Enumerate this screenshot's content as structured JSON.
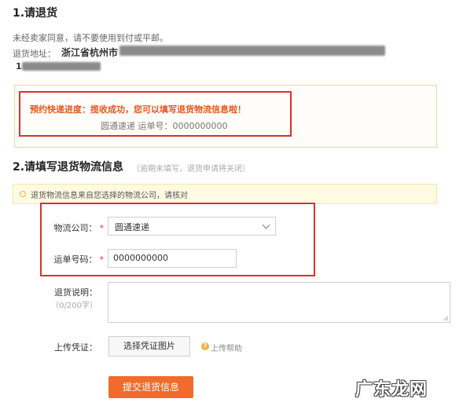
{
  "section1": {
    "title": "1.请退货",
    "note": "未经卖家同意，请不要使用到付或平邮。",
    "address_label": "退货地址：",
    "address_visible": "浙江省杭州市",
    "phone_visible": "1"
  },
  "notice": {
    "progress_label": "预约快递进度：",
    "progress_msg": "揽收成功，您可以填写退货物流信息啦！",
    "courier": "圆通速递",
    "tracking_label": "运单号：",
    "tracking_no": "0000000000"
  },
  "section2": {
    "title": "2.请填写退货物流信息",
    "subtitle": "（逾期未填写，退货申请将关闭）"
  },
  "tip": {
    "text": "退货物流信息来自您选择的物流公司，请核对"
  },
  "form": {
    "company_label": "物流公司：",
    "company_value": "圆通速递",
    "tracking_label": "运单号码：",
    "tracking_value": "0000000000",
    "desc_label": "退货说明：",
    "desc_counter": "（0/200字）",
    "upload_label": "上传凭证：",
    "upload_button": "选择凭证图片",
    "upload_help": "上传帮助",
    "required_mark": "*",
    "submit_button": "提交退货信息"
  },
  "watermark": {
    "text": "广东龙网"
  }
}
